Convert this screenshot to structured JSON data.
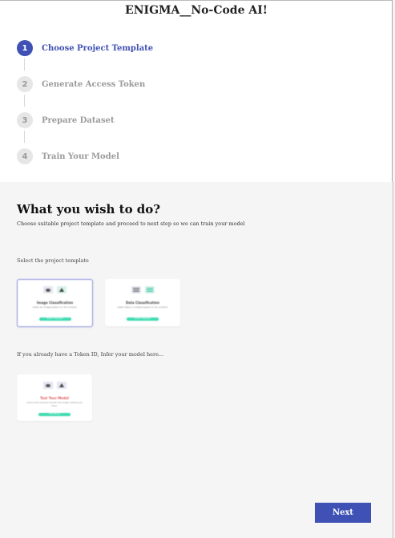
{
  "app": {
    "title": "ENIGMA__No-Code AI!"
  },
  "stepper": {
    "steps": [
      {
        "number": "1",
        "label": "Choose Project Template",
        "active": true
      },
      {
        "number": "2",
        "label": "Generate Access Token",
        "active": false
      },
      {
        "number": "3",
        "label": "Prepare Dataset",
        "active": false
      },
      {
        "number": "4",
        "label": "Train Your Model",
        "active": false
      }
    ]
  },
  "main": {
    "heading": "What you wish to do?",
    "subheading": "Choose suitable project template and proceed to next step so we can train your model",
    "template_section_label": "Select the project template",
    "templates": [
      {
        "title": "Image Classification",
        "description": "Label an image based on its content.",
        "button": "Select Template",
        "selected": true
      },
      {
        "title": "Data Classification",
        "description": "Label data in a table based on its content.",
        "button": "Select Template",
        "selected": false
      }
    ],
    "infer_section_label": "If you already have a Token ID, Infer your model here...",
    "infer_card": {
      "title": "Test Your Model",
      "description": "Check the trained model and make inferences here.",
      "button": "Test Model"
    }
  },
  "footer": {
    "next_label": "Next"
  },
  "colors": {
    "primary": "#3f51b5",
    "accent_green": "#3ddbb0",
    "inactive_step": "#9a9a9a",
    "background": "#f5f5f5",
    "test_title_red": "#e05555"
  }
}
